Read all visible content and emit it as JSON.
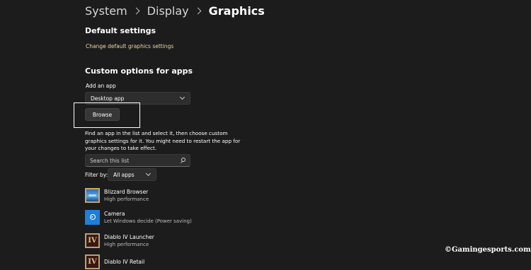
{
  "breadcrumb": {
    "items": [
      "System",
      "Display",
      "Graphics"
    ]
  },
  "default_settings": {
    "title": "Default settings",
    "link": "Change default graphics settings"
  },
  "custom_options": {
    "title": "Custom options for apps",
    "add_app_label": "Add an app",
    "app_type_selected": "Desktop app",
    "browse_label": "Browse",
    "description": "Find an app in the list and select it, then choose custom graphics settings for it. You might need to restart the app for your changes to take effect.",
    "search_placeholder": "Search this list",
    "filter_label": "Filter by:",
    "filter_selected": "All apps"
  },
  "apps": [
    {
      "name": "Blizzard Browser",
      "preference": "High performance",
      "icon": "blizzard-browser-icon"
    },
    {
      "name": "Camera",
      "preference": "Let Windows decide (Power saving)",
      "icon": "camera-icon"
    },
    {
      "name": "Diablo IV Launcher",
      "preference": "High performance",
      "icon": "diablo-iv-icon"
    },
    {
      "name": "Diablo IV Retail",
      "preference": "",
      "icon": "diablo-iv-icon"
    }
  ],
  "watermark": "©Gamingesports.com",
  "colors": {
    "background": "#1c1c1c",
    "link": "#e8d9a6",
    "control": "#2d2d2d",
    "highlight_box": "#ffffff"
  }
}
